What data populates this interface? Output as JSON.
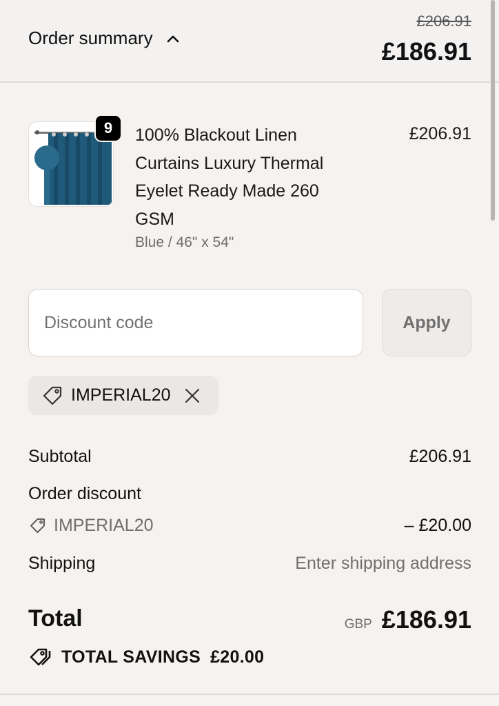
{
  "header": {
    "toggle_label": "Order summary",
    "toggle_icon": "chevron-up-icon",
    "original_total": "£206.91",
    "total": "£186.91"
  },
  "product": {
    "quantity": "9",
    "title": "100% Blackout Linen Curtains Luxury Thermal Eyelet Ready Made 260 GSM",
    "variant": "Blue / 46\" x 54\"",
    "price": "£206.91",
    "thumbnail_color": "#1f5a7a"
  },
  "discount": {
    "placeholder": "Discount code",
    "value": "",
    "apply_label": "Apply",
    "applied_code": "IMPERIAL20"
  },
  "summary": {
    "subtotal_label": "Subtotal",
    "subtotal_value": "£206.91",
    "order_discount_label": "Order discount",
    "discount_code": "IMPERIAL20",
    "discount_value": "– £20.00",
    "shipping_label": "Shipping",
    "shipping_value": "Enter shipping address",
    "total_label": "Total",
    "currency": "GBP",
    "total_value": "£186.91",
    "savings_label": "TOTAL SAVINGS",
    "savings_value": "£20.00"
  },
  "colors": {
    "background": "#f6f2ef",
    "header_background": "#f3f2f1",
    "text": "#111111",
    "muted_text": "#6f6f6f"
  }
}
